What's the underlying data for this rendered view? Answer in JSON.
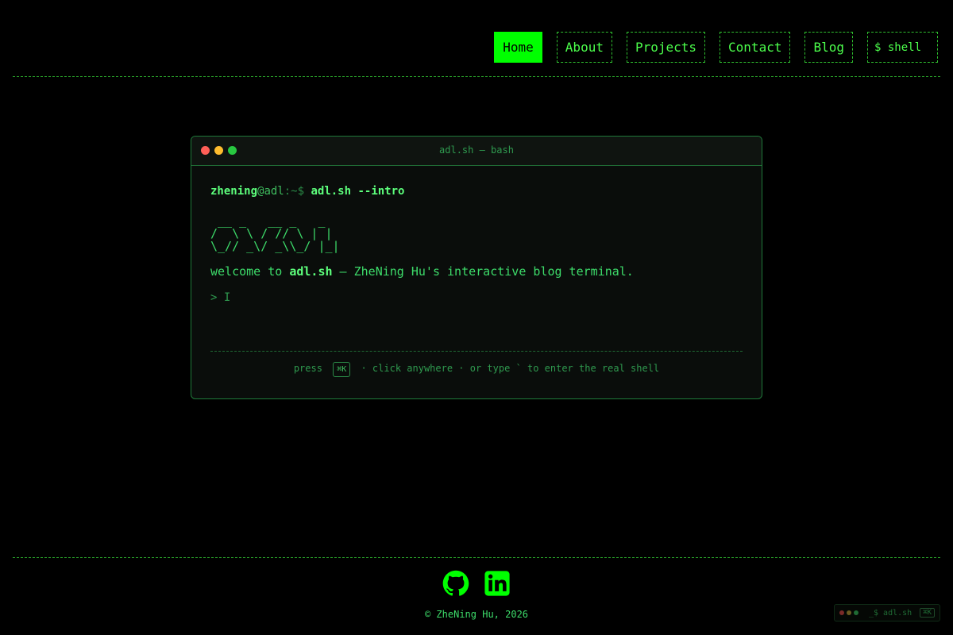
{
  "nav": {
    "home": "Home",
    "about": "About",
    "projects": "Projects",
    "contact": "Contact",
    "blog": "Blog",
    "shell": "$ shell"
  },
  "terminal": {
    "title": "adl.sh — bash",
    "prompt_user": "zhening",
    "prompt_host": "@adl",
    "prompt_sep": ":~$",
    "command": "adl.sh --intro",
    "ascii_art": " __ _   __ _   _ \n/  \\ \\ / // \\ | |\n\\_// _\\/ _\\\\_/ |_|",
    "welcome_prefix": "welcome to ",
    "welcome_brand": "adl.sh",
    "welcome_suffix": " — ZheNing Hu's interactive blog terminal.",
    "input_prompt": "> I",
    "hint_press": "press",
    "hint_key": "⌘K",
    "hint_rest": "· click anywhere · or type ` to enter the real shell"
  },
  "footer": {
    "icons": [
      "github-icon",
      "linkedin-icon"
    ],
    "copyright": "© ZheNing Hu, 2026"
  },
  "mini_terminal": {
    "label": "_$ adl.sh",
    "key": "⌘K"
  },
  "colors": {
    "accent": "#00ff00",
    "text": "#4cff4c",
    "background": "#000000",
    "dot_red": "#ff5f57",
    "dot_yellow": "#febc2e",
    "dot_green": "#28c840"
  }
}
